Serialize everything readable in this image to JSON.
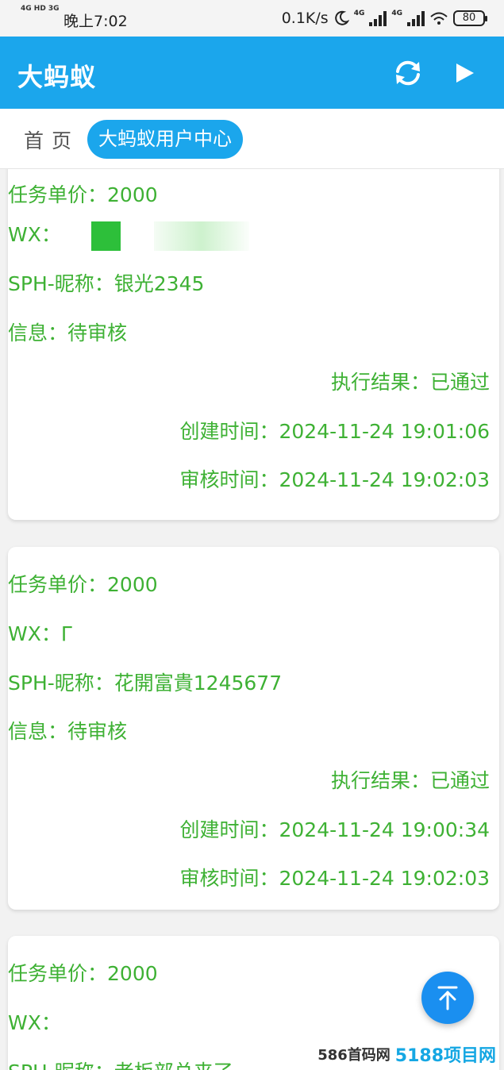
{
  "status_bar": {
    "signal_small": "4G HD 3G",
    "time": "晚上7:02",
    "speed": "0.1K/s",
    "net1": "4G",
    "net2": "4G",
    "battery": "80"
  },
  "app_bar": {
    "title": "大蚂蚁"
  },
  "tabs": {
    "home": "首页",
    "active": "大蚂蚁用户中心"
  },
  "records": [
    {
      "price_label": "任务单价：",
      "price": "2000",
      "wx_label": "WX：",
      "nickname_label": "SPH-昵称：",
      "nickname": "银光2345",
      "info_label": "信息：",
      "info": "待审核",
      "result_label": "执行结果：",
      "result": "已通过",
      "created_label": "创建时间：",
      "created": "2024-11-24 19:01:06",
      "reviewed_label": "审核时间：",
      "reviewed": "2024-11-24 19:02:03"
    },
    {
      "price_label": "任务单价：",
      "price": "2000",
      "wx_label": "WX：",
      "wx": "Γ",
      "nickname_label": "SPH-昵称：",
      "nickname": "花開富貴1245677",
      "info_label": "信息：",
      "info": "待审核",
      "result_label": "执行结果：",
      "result": "已通过",
      "created_label": "创建时间：",
      "created": "2024-11-24 19:00:34",
      "reviewed_label": "审核时间：",
      "reviewed": "2024-11-24 19:02:03"
    },
    {
      "price_label": "任务单价：",
      "price": "2000",
      "wx_label": "WX：",
      "nickname_label": "SPH-昵称：",
      "nickname": "老板部总来了"
    }
  ],
  "watermark": {
    "small": "586首码网",
    "big": "5188项目网"
  },
  "colors": {
    "primary": "#1ba6ec",
    "text_green": "#3eb134",
    "fab": "#1a8ff0"
  },
  "icons": {
    "refresh": "refresh-icon",
    "play": "play-icon",
    "scroll_top": "arrow-up-icon"
  }
}
